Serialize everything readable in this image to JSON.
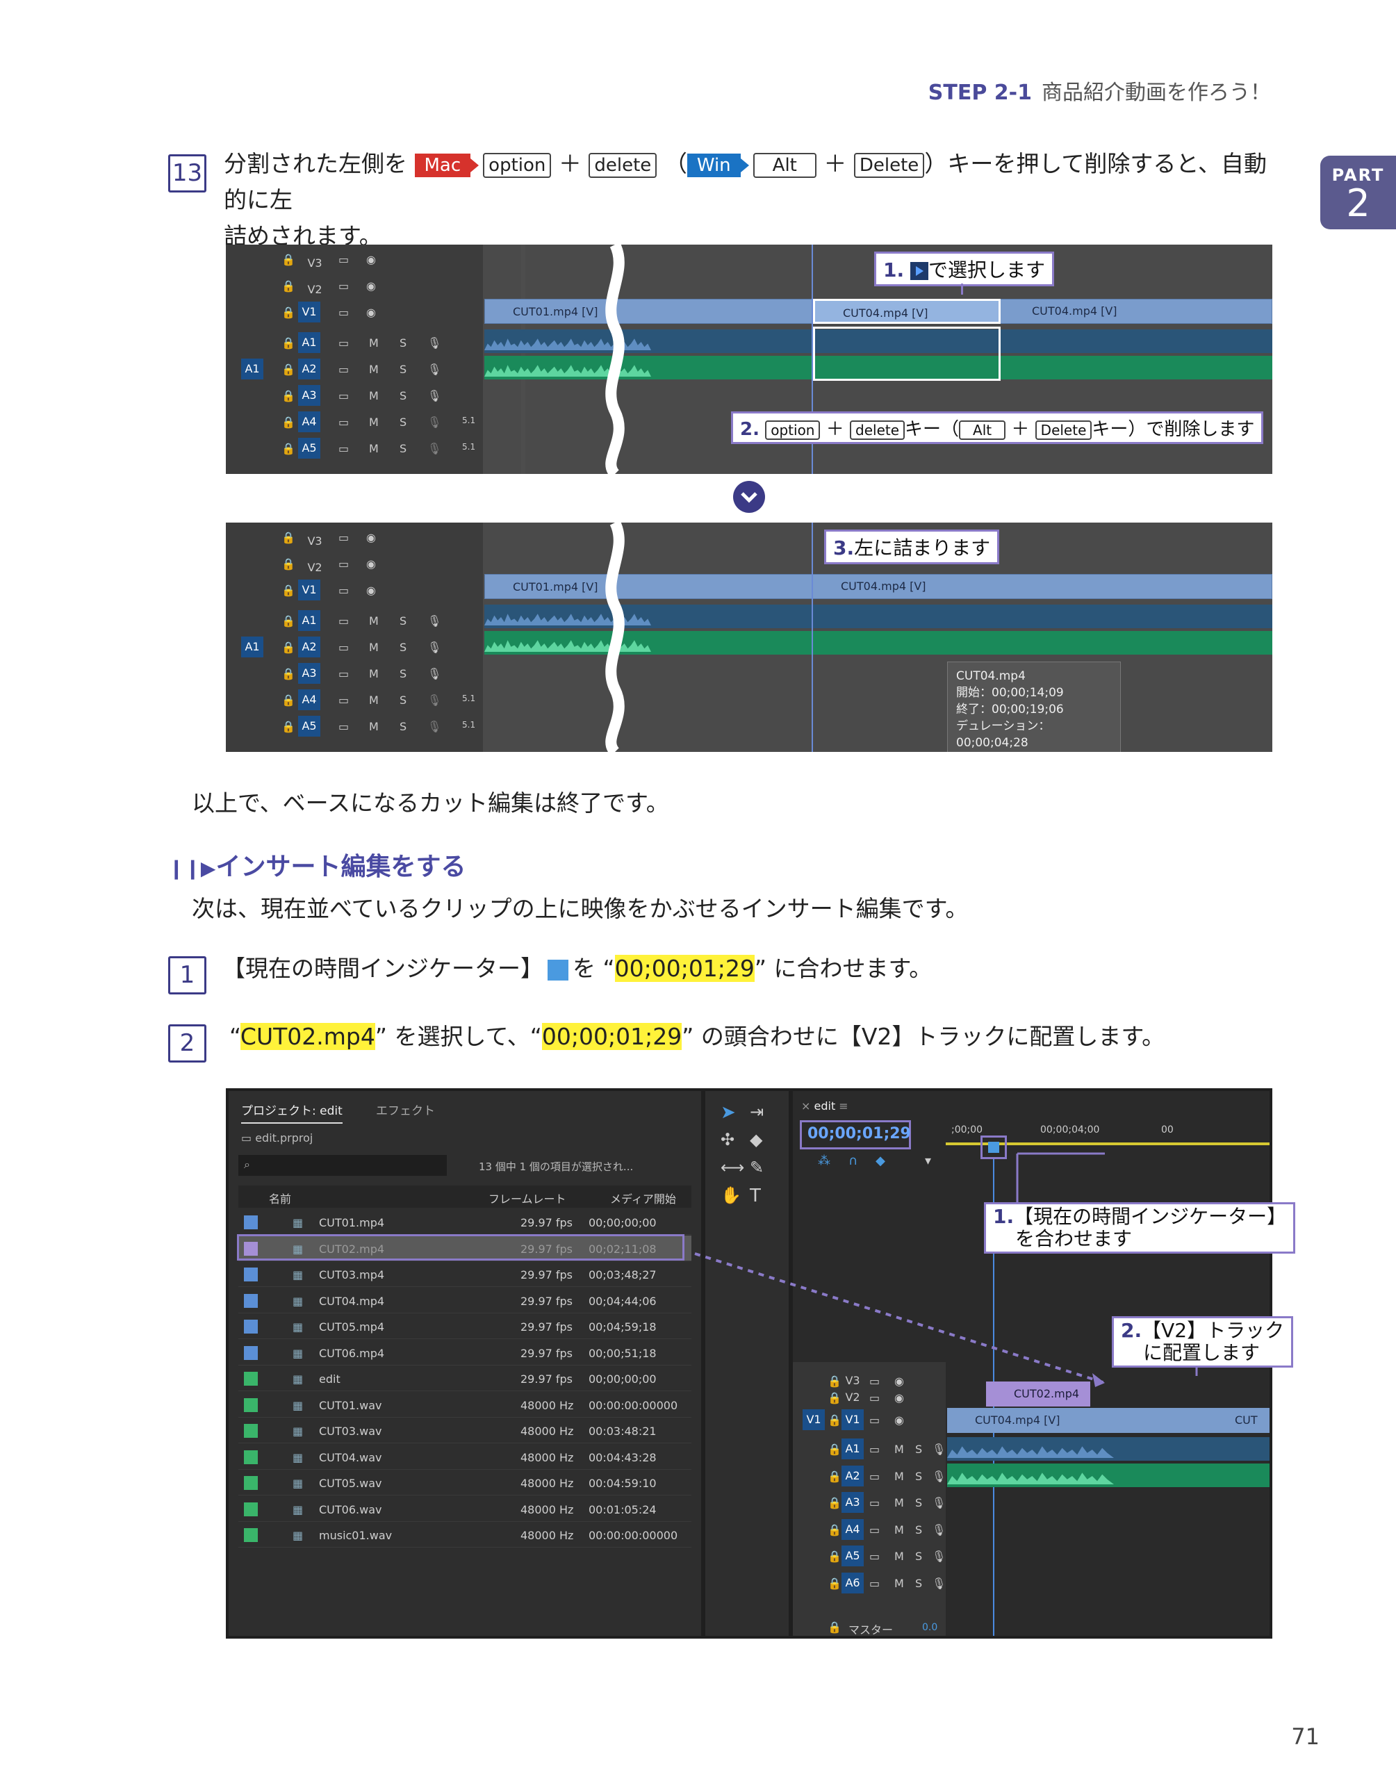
{
  "header": {
    "step": "STEP 2-1",
    "title": "商品紹介動画を作ろう！"
  },
  "part": {
    "label": "PART",
    "num": "2"
  },
  "step13": {
    "num": "13",
    "t1": "分割された左側を",
    "mac": "Mac",
    "k1": "option",
    "plus": "＋",
    "k2": "delete",
    "paren_open": "（",
    "win": "Win",
    "k3": "Alt",
    "k4": "Delete",
    "t2": "）キーを押して削除すると、自動的に左",
    "line2": "詰めされます。"
  },
  "tl1": {
    "callout1_num": "1.",
    "callout1_text": "で選択します",
    "callout2_num": "2.",
    "callout2_k1": "option",
    "callout2_k2": "delete",
    "callout2_mid": "キー（",
    "callout2_k3": "Alt",
    "callout2_k4": "Delete",
    "callout2_end": "キー）で削除します",
    "clip1": "CUT01.mp4 [V]",
    "clip2": "CUT04.mp4 [V]",
    "clip3": "CUT04.mp4 [V]"
  },
  "tl2": {
    "callout_num": "3.",
    "callout_text": "左に詰まります",
    "clip1": "CUT01.mp4 [V]",
    "clip2": "CUT04.mp4 [V]",
    "tip_name": "CUT04.mp4",
    "tip_start": "開始：00;00;14;09",
    "tip_end": "終了：00;00;19;06",
    "tip_dur": "デュレーション：00;00;04;28"
  },
  "tracks_v": [
    "V3",
    "V2",
    "V1"
  ],
  "tracks_a": [
    "A1",
    "A2",
    "A3",
    "A4",
    "A5"
  ],
  "track_src_a": "A1",
  "trk_m": "M",
  "trk_s": "S",
  "trk_51": "5.1",
  "summary": "以上で、ベースになるカット編集は終了です。",
  "section": {
    "title": "インサート編集をする",
    "lead": "次は、現在並べているクリップの上に映像をかぶせるインサート編集です。"
  },
  "step1": {
    "num": "1",
    "t1": "【現在の時間インジケーター】",
    "t2": "を “",
    "hl": "00;00;01;29",
    "t3": "” に合わせます。"
  },
  "step2": {
    "num": "2",
    "q1": "“",
    "hl1": "CUT02.mp4",
    "t1": "” を選択して、“",
    "hl2": "00;00;01;29",
    "t2": "” の頭合わせに【V2】トラックに配置します。"
  },
  "project": {
    "tab1": "プロジェクト: edit",
    "tab2": "エフェクト",
    "file": "edit.prproj",
    "status": "13 個中 1 個の項目が選択され...",
    "col_name": "名前",
    "col_fps": "フレームレート",
    "col_start": "メディア開始",
    "rows": [
      {
        "name": "CUT01.mp4",
        "fps": "29.97 fps",
        "start": "00;00;00;00",
        "color": "#5b8fd6"
      },
      {
        "name": "CUT02.mp4",
        "fps": "29.97 fps",
        "start": "00;02;11;08",
        "color": "#a58fd6"
      },
      {
        "name": "CUT03.mp4",
        "fps": "29.97 fps",
        "start": "00;03;48;27",
        "color": "#5b8fd6"
      },
      {
        "name": "CUT04.mp4",
        "fps": "29.97 fps",
        "start": "00;04;44;06",
        "color": "#5b8fd6"
      },
      {
        "name": "CUT05.mp4",
        "fps": "29.97 fps",
        "start": "00;04;59;18",
        "color": "#5b8fd6"
      },
      {
        "name": "CUT06.mp4",
        "fps": "29.97 fps",
        "start": "00;00;51;18",
        "color": "#5b8fd6"
      },
      {
        "name": "edit",
        "fps": "29.97 fps",
        "start": "00;00;00;00",
        "color": "#3ab56a"
      },
      {
        "name": "CUT01.wav",
        "fps": "48000 Hz",
        "start": "00:00:00:00000",
        "color": "#3ab56a"
      },
      {
        "name": "CUT03.wav",
        "fps": "48000 Hz",
        "start": "00:03:48:21",
        "color": "#3ab56a"
      },
      {
        "name": "CUT04.wav",
        "fps": "48000 Hz",
        "start": "00:04:43:28",
        "color": "#3ab56a"
      },
      {
        "name": "CUT05.wav",
        "fps": "48000 Hz",
        "start": "00:04:59:10",
        "color": "#3ab56a"
      },
      {
        "name": "CUT06.wav",
        "fps": "48000 Hz",
        "start": "00:01:05:24",
        "color": "#3ab56a"
      },
      {
        "name": "music01.wav",
        "fps": "48000 Hz",
        "start": "00:00:00:00000",
        "color": "#3ab56a"
      }
    ]
  },
  "seq": {
    "tab": "edit",
    "timecode": "00;00;01;29",
    "ruler1": ";00;00",
    "ruler2": "00;00;04;00",
    "ruler3": "00",
    "callout1_num": "1.",
    "callout1_l1": "【現在の時間インジケーター】",
    "callout1_l2": "を合わせます",
    "callout2_num": "2.",
    "callout2_l1": "【V2】トラック",
    "callout2_l2": "に配置します",
    "drag_clip": "CUT02.mp4",
    "v1_clip": "CUT04.mp4 [V]",
    "v1_clip2": "CUT",
    "v_tracks": [
      "V3",
      "V2",
      "V1"
    ],
    "a_tracks": [
      "A1",
      "A2",
      "A3",
      "A4",
      "A5",
      "A6"
    ],
    "src_v": "V1",
    "master": "マスター",
    "master_val": "0.0"
  },
  "page_num": "71"
}
